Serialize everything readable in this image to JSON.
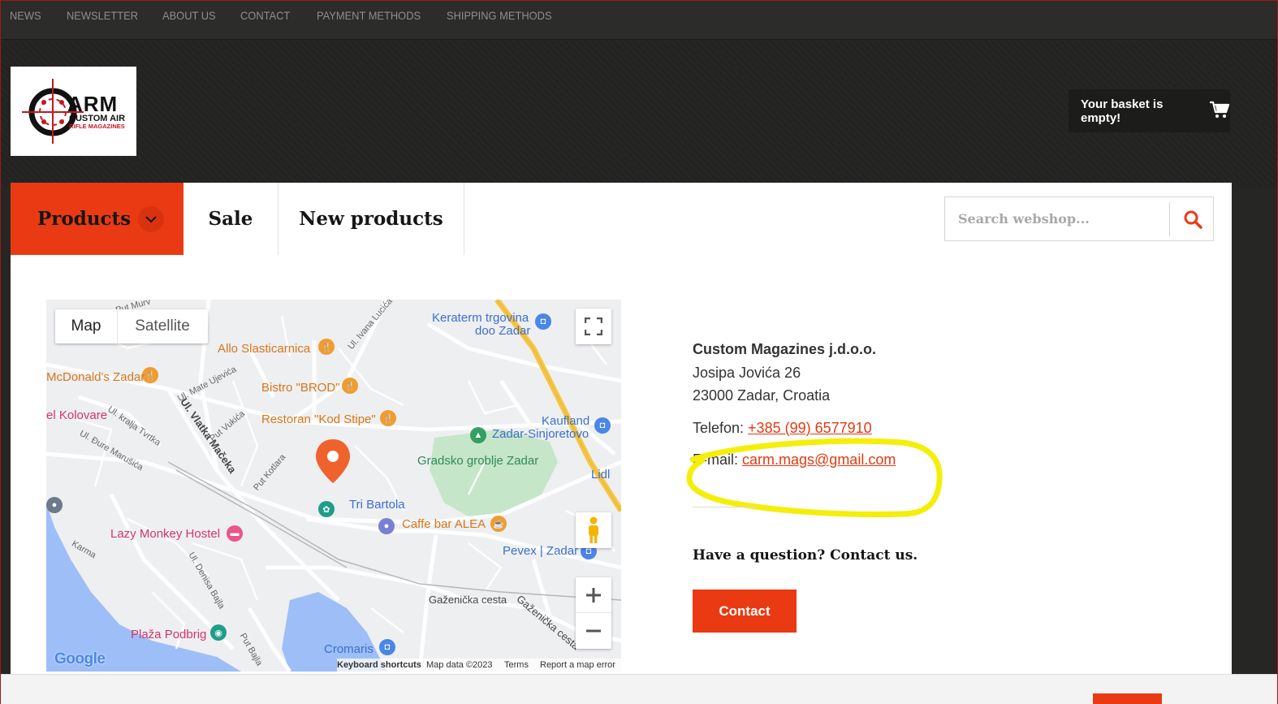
{
  "topnav": {
    "items": [
      "NEWS",
      "NEWSLETTER",
      "ABOUT US",
      "CONTACT",
      "PAYMENT METHODS",
      "SHIPPING METHODS"
    ]
  },
  "logo": {
    "brand": "ARM",
    "line1": "CUSTOM AIR",
    "line2": "RIFLE MAGAZINES"
  },
  "basket": {
    "label": "Your basket is empty!",
    "icon": "cart-icon"
  },
  "mainnav": {
    "products": "Products",
    "sale": "Sale",
    "new_products": "New products"
  },
  "search": {
    "placeholder": "Search webshop...",
    "icon": "search-icon"
  },
  "map": {
    "type_map": "Map",
    "type_satellite": "Satellite",
    "pois": {
      "keraterm": "Keraterm trgovina",
      "keraterm2": "doo Zadar",
      "allo": "Allo Slasticarnica",
      "mcdonalds": "McDonald's Zadar",
      "bistro": "Bistro \"BROD\"",
      "restoran": "Restoran \"Kod Stipe\"",
      "kolovare": "el Kolovare",
      "kaufland": "Kaufland",
      "sinjoretovo": "Zadar-Sinjoretovo",
      "groblje": "Gradsko groblje Zadar",
      "lidl": "Lidl",
      "tribartola": "Tri Bartola",
      "caffe": "Caffe bar ALEA",
      "lazymonkey": "Lazy Monkey Hostel",
      "pevex": "Pevex | Zadar",
      "plaza": "Plaža Podbrig",
      "cromaris": "Cromaris"
    },
    "streets": {
      "ivana": "Ul. Ivana Lucića",
      "mate": "Ul. Mate Ujevića",
      "vlatka": "Ul. Vlatka Mačeka",
      "vukica": "Put Vukića",
      "tvrtka": "Ul. kralja Tvrtka",
      "durem": "Ul. Đure Marušića",
      "kotlara": "Put Kotlara",
      "karma": "Karma",
      "denisa": "Ul. Denisa Bajla",
      "bajla": "Put Bajla",
      "gazenicka": "Gaženička cesta",
      "gazenicka2": "Gaženička cesta",
      "murv": "Put Murv"
    },
    "google": "Google",
    "footer": {
      "shortcuts": "Keyboard shortcuts",
      "data": "Map data ©2023",
      "terms": "Terms",
      "report": "Report a map error"
    }
  },
  "address": {
    "company": "Custom Magazines j.d.o.o.",
    "street": "Josipa Jovića 26",
    "city": "23000 Zadar, Croatia",
    "phone_label": "Telefon: ",
    "phone": "+385 (99) 6577910",
    "email_label": "E-mail: ",
    "email": "carm.mags@gmail.com"
  },
  "question": "Have a question? Contact us.",
  "contact_button": "Contact",
  "colors": {
    "accent": "#ea3a13",
    "highlight": "#f5ee0a"
  }
}
